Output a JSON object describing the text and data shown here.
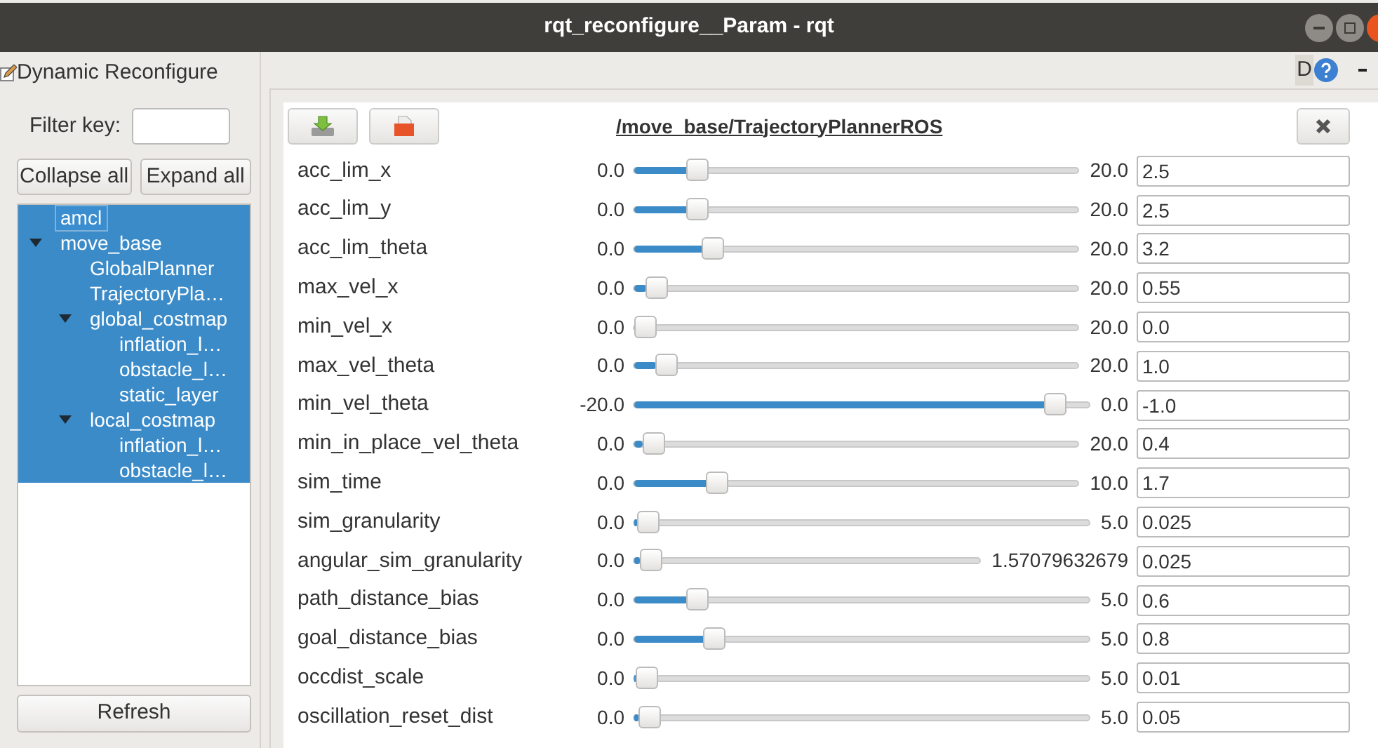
{
  "window": {
    "title": "rqt_reconfigure__Param - rqt"
  },
  "plugin": {
    "title": "Dynamic Reconfigure",
    "help_label": "D"
  },
  "sidebar": {
    "filter": {
      "label": "Filter key:"
    },
    "buttons": [
      "Collapse all",
      "Expand all"
    ],
    "tree": [
      {
        "label": "amcl",
        "selected": true,
        "focused": true
      },
      {
        "label": "move_base",
        "selected": true,
        "expanded": true,
        "children": [
          {
            "label": "GlobalPlanner",
            "selected": true
          },
          {
            "label": "TrajectoryPla…",
            "selected": true
          },
          {
            "label": "global_costmap",
            "selected": true,
            "expanded": true,
            "children": [
              {
                "label": "inflation_l…",
                "selected": true
              },
              {
                "label": "obstacle_l…",
                "selected": true
              },
              {
                "label": "static_layer",
                "selected": true
              }
            ]
          },
          {
            "label": "local_costmap",
            "selected": true,
            "expanded": true,
            "children": [
              {
                "label": "inflation_l…",
                "selected": true
              },
              {
                "label": "obstacle_l…",
                "selected": true
              }
            ]
          }
        ]
      }
    ],
    "refresh": "Refresh"
  },
  "panel": {
    "title": "/move_base/TrajectoryPlannerROS",
    "params": [
      {
        "name": "acc_lim_x",
        "min": "0.0",
        "max": "20.0",
        "value": "2.5",
        "level": 0.125
      },
      {
        "name": "acc_lim_y",
        "min": "0.0",
        "max": "20.0",
        "value": "2.5",
        "level": 0.125
      },
      {
        "name": "acc_lim_theta",
        "min": "0.0",
        "max": "20.0",
        "value": "3.2",
        "level": 0.16
      },
      {
        "name": "max_vel_x",
        "min": "0.0",
        "max": "20.0",
        "value": "0.55",
        "level": 0.0275
      },
      {
        "name": "min_vel_x",
        "min": "0.0",
        "max": "20.0",
        "value": "0.0",
        "level": 0
      },
      {
        "name": "max_vel_theta",
        "min": "0.0",
        "max": "20.0",
        "value": "1.0",
        "level": 0.05
      },
      {
        "name": "min_vel_theta",
        "min": "-20.0",
        "max": "0.0",
        "value": "-1.0",
        "level": 0.95
      },
      {
        "name": "min_in_place_vel_theta",
        "min": "0.0",
        "max": "20.0",
        "value": "0.4",
        "level": 0.02
      },
      {
        "name": "sim_time",
        "min": "0.0",
        "max": "10.0",
        "value": "1.7",
        "level": 0.17
      },
      {
        "name": "sim_granularity",
        "min": "0.0",
        "max": "5.0",
        "value": "0.025",
        "level": 0.005
      },
      {
        "name": "angular_sim_granularity",
        "min": "0.0",
        "max": "1.57079632679",
        "value": "0.025",
        "level": 0.016
      },
      {
        "name": "path_distance_bias",
        "min": "0.0",
        "max": "5.0",
        "value": "0.6",
        "level": 0.12
      },
      {
        "name": "goal_distance_bias",
        "min": "0.0",
        "max": "5.0",
        "value": "0.8",
        "level": 0.16
      },
      {
        "name": "occdist_scale",
        "min": "0.0",
        "max": "5.0",
        "value": "0.01",
        "level": 0.002
      },
      {
        "name": "oscillation_reset_dist",
        "min": "0.0",
        "max": "5.0",
        "value": "0.05",
        "level": 0.01
      }
    ]
  }
}
